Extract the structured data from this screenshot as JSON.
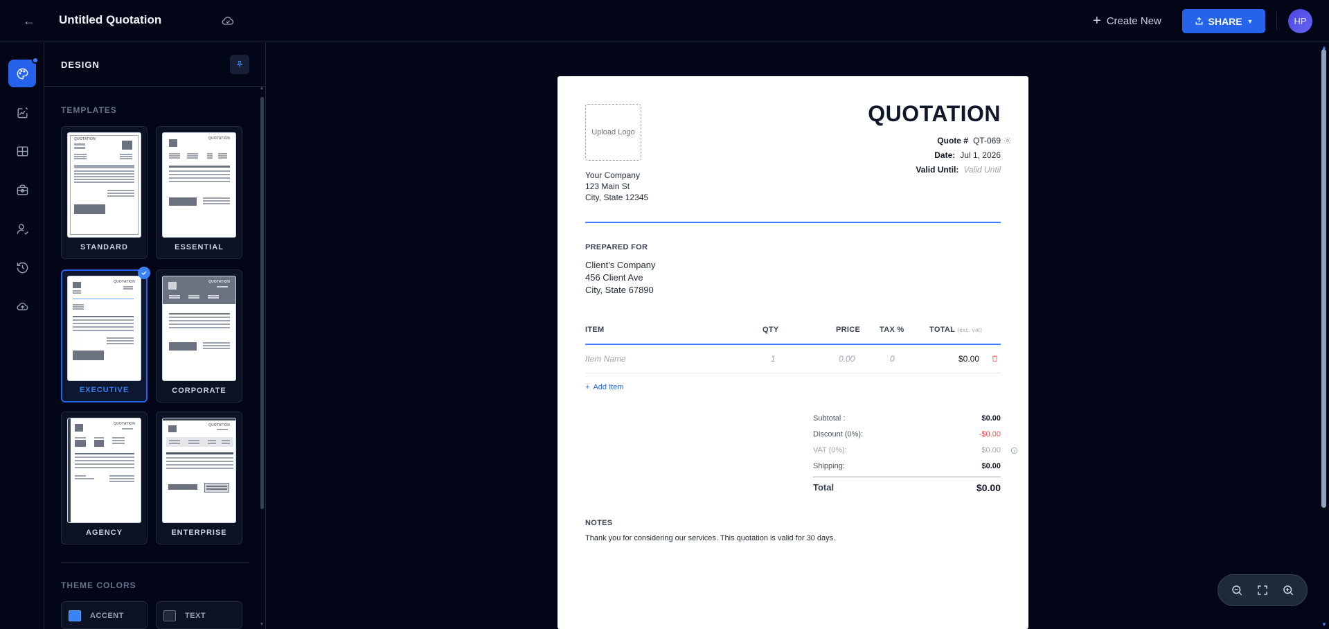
{
  "header": {
    "title": "Untitled Quotation",
    "create_new": "Create New",
    "share": "SHARE",
    "avatar": "HP"
  },
  "rail": {
    "icons": [
      "palette-icon",
      "chart-edit-icon",
      "grid-icon",
      "briefcase-icon",
      "user-check-icon",
      "history-icon",
      "cloud-upload-icon"
    ]
  },
  "design_panel": {
    "title": "DESIGN",
    "templates_label": "TEMPLATES",
    "templates": [
      {
        "label": "STANDARD"
      },
      {
        "label": "ESSENTIAL"
      },
      {
        "label": "EXECUTIVE",
        "selected": true
      },
      {
        "label": "CORPORATE"
      },
      {
        "label": "AGENCY"
      },
      {
        "label": "ENTERPRISE"
      }
    ],
    "thumb_title": "QUOTATION",
    "theme_colors_label": "THEME COLORS",
    "colors": [
      {
        "label": "ACCENT",
        "value": "#3b82f6"
      },
      {
        "label": "TEXT",
        "value": "#1f2937"
      }
    ]
  },
  "document": {
    "upload_logo": "Upload Logo",
    "company": [
      "Your Company",
      "123 Main St",
      "City, State 12345"
    ],
    "title": "QUOTATION",
    "quote_label": "Quote #",
    "quote_value": "QT-069",
    "date_label": "Date:",
    "date_value": "Jul 1, 2026",
    "valid_label": "Valid Until:",
    "valid_placeholder": "Valid Until",
    "prepared_for_label": "PREPARED FOR",
    "client": [
      "Client's Company",
      "456 Client Ave",
      "City, State 67890"
    ],
    "table": {
      "headers": {
        "item": "ITEM",
        "qty": "QTY",
        "price": "PRICE",
        "tax": "TAX %",
        "total": "TOTAL",
        "total_note": "(exc. vat)"
      },
      "rows": [
        {
          "item": "Item Name",
          "qty": "1",
          "price": "0.00",
          "tax": "0",
          "total": "$0.00"
        }
      ]
    },
    "add_item": "Add Item",
    "totals": {
      "subtotal_label": "Subtotal :",
      "subtotal": "$0.00",
      "discount_label": "Discount (0%):",
      "discount": "-$0.00",
      "vat_label": "VAT (0%):",
      "vat": "$0.00",
      "shipping_label": "Shipping:",
      "shipping": "$0.00",
      "total_label": "Total",
      "total": "$0.00"
    },
    "notes_label": "NOTES",
    "notes_text": "Thank you for considering our services. This quotation is valid for 30 days."
  },
  "colors": {
    "accent": "#2563eb",
    "background": "#020617"
  }
}
